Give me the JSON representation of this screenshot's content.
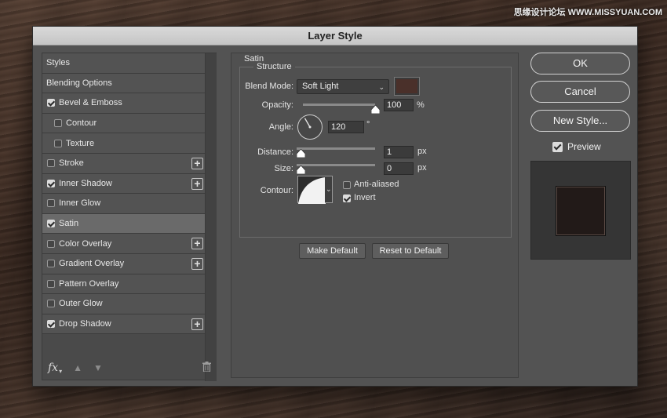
{
  "watermark": "思缘设计论坛 WWW.MISSYUAN.COM",
  "dialog": {
    "title": "Layer Style"
  },
  "styles_panel": {
    "items": [
      {
        "label": "Styles",
        "checkbox": false,
        "checked": false,
        "plus": false,
        "sub": false,
        "selected": false
      },
      {
        "label": "Blending Options",
        "checkbox": false,
        "checked": false,
        "plus": false,
        "sub": false,
        "selected": false
      },
      {
        "label": "Bevel & Emboss",
        "checkbox": true,
        "checked": true,
        "plus": false,
        "sub": false,
        "selected": false
      },
      {
        "label": "Contour",
        "checkbox": true,
        "checked": false,
        "plus": false,
        "sub": true,
        "selected": false
      },
      {
        "label": "Texture",
        "checkbox": true,
        "checked": false,
        "plus": false,
        "sub": true,
        "selected": false
      },
      {
        "label": "Stroke",
        "checkbox": true,
        "checked": false,
        "plus": true,
        "sub": false,
        "selected": false
      },
      {
        "label": "Inner Shadow",
        "checkbox": true,
        "checked": true,
        "plus": true,
        "sub": false,
        "selected": false
      },
      {
        "label": "Inner Glow",
        "checkbox": true,
        "checked": false,
        "plus": false,
        "sub": false,
        "selected": false
      },
      {
        "label": "Satin",
        "checkbox": true,
        "checked": true,
        "plus": false,
        "sub": false,
        "selected": true
      },
      {
        "label": "Color Overlay",
        "checkbox": true,
        "checked": false,
        "plus": true,
        "sub": false,
        "selected": false
      },
      {
        "label": "Gradient Overlay",
        "checkbox": true,
        "checked": false,
        "plus": true,
        "sub": false,
        "selected": false
      },
      {
        "label": "Pattern Overlay",
        "checkbox": true,
        "checked": false,
        "plus": false,
        "sub": false,
        "selected": false
      },
      {
        "label": "Outer Glow",
        "checkbox": true,
        "checked": false,
        "plus": false,
        "sub": false,
        "selected": false
      },
      {
        "label": "Drop Shadow",
        "checkbox": true,
        "checked": true,
        "plus": true,
        "sub": false,
        "selected": false
      }
    ],
    "fx_label": "fx"
  },
  "satin": {
    "section_label": "Satin",
    "structure_label": "Structure",
    "blend_mode_label": "Blend Mode:",
    "blend_mode_value": "Soft Light",
    "color": "#4a302a",
    "opacity_label": "Opacity:",
    "opacity_value": "100",
    "opacity_unit": "%",
    "opacity_fraction": 1.0,
    "angle_label": "Angle:",
    "angle_value": "120",
    "angle_unit": "°",
    "distance_label": "Distance:",
    "distance_value": "1",
    "distance_unit": "px",
    "size_label": "Size:",
    "size_value": "0",
    "size_unit": "px",
    "contour_label": "Contour:",
    "anti_aliased_label": "Anti-aliased",
    "anti_aliased_checked": false,
    "invert_label": "Invert",
    "invert_checked": true,
    "make_default_label": "Make Default",
    "reset_default_label": "Reset to Default"
  },
  "actions": {
    "ok_label": "OK",
    "cancel_label": "Cancel",
    "new_style_label": "New Style...",
    "preview_label": "Preview",
    "preview_checked": true
  },
  "preview_color": "#221a18"
}
